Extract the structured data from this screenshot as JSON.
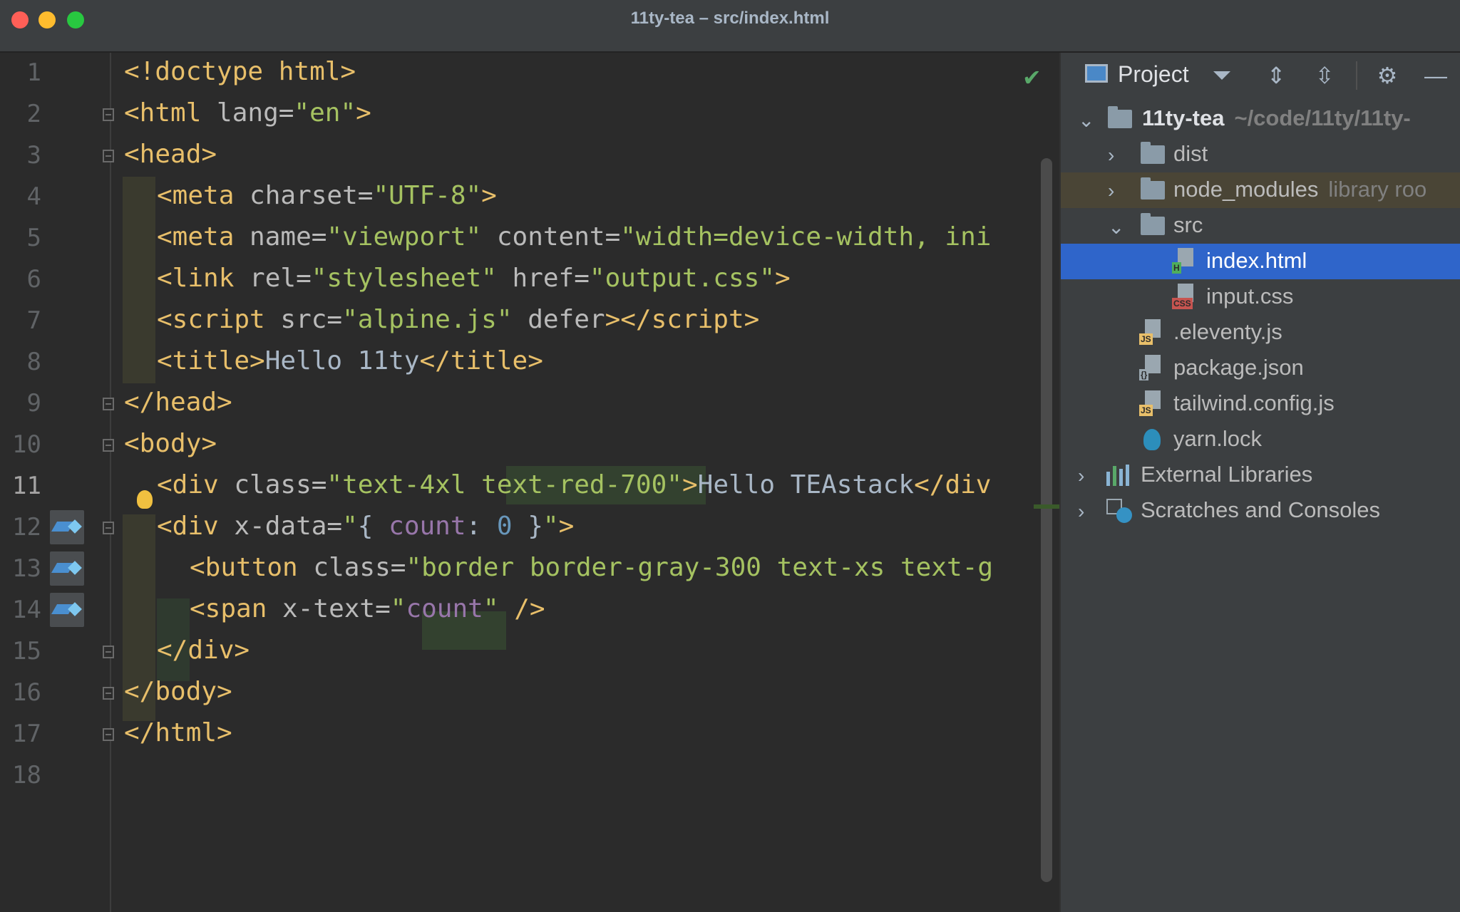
{
  "window": {
    "title": "11ty-tea – src/index.html"
  },
  "editor": {
    "current_line": 11,
    "lines": [
      {
        "num": "1"
      },
      {
        "num": "2"
      },
      {
        "num": "3"
      },
      {
        "num": "4"
      },
      {
        "num": "5"
      },
      {
        "num": "6"
      },
      {
        "num": "7"
      },
      {
        "num": "8"
      },
      {
        "num": "9"
      },
      {
        "num": "10"
      },
      {
        "num": "11"
      },
      {
        "num": "12"
      },
      {
        "num": "13"
      },
      {
        "num": "14"
      },
      {
        "num": "15"
      },
      {
        "num": "16"
      },
      {
        "num": "17"
      },
      {
        "num": "18"
      }
    ],
    "code": {
      "l1": [
        "<!doctype html>"
      ],
      "l2": [
        "<html",
        " lang=",
        "\"en\"",
        ">"
      ],
      "l3": [
        "<head>"
      ],
      "l4": [
        "<meta",
        " charset=",
        "\"UTF-8\"",
        ">"
      ],
      "l5": [
        "<meta",
        " name=",
        "\"viewport\"",
        " content=",
        "\"width=device-width, ini"
      ],
      "l6": [
        "<link",
        " rel=",
        "\"stylesheet\"",
        " href=",
        "\"output.css\"",
        ">"
      ],
      "l7": [
        "<script",
        " src=",
        "\"alpine.js\"",
        " defer",
        "></",
        "script>"
      ],
      "l8": [
        "<title>",
        "Hello 11ty",
        "</",
        "title>"
      ],
      "l9": [
        "</",
        "head>"
      ],
      "l10": [
        "<body>"
      ],
      "l11": [
        "<div",
        " class=",
        "\"text-4xl ",
        "text-red-700",
        "\"",
        ">",
        "Hello TEAstack",
        "</",
        "div"
      ],
      "l12": [
        "<div",
        " x-data=",
        "\"",
        "{ ",
        "count",
        ": ",
        "0",
        " }",
        "\"",
        ">"
      ],
      "l13": [
        "<button",
        " class=",
        "\"border border-gray-300 text-xs text-g"
      ],
      "l14": [
        "<span",
        " x-text=",
        "\"",
        "count",
        "\"",
        " />"
      ],
      "l15": [
        "</",
        "div>"
      ],
      "l16": [
        "</",
        "body>"
      ],
      "l17": [
        "</",
        "html>"
      ]
    }
  },
  "project_panel": {
    "title": "Project",
    "root": {
      "name": "11ty-tea",
      "path": "~/code/11ty/11ty-"
    },
    "items": {
      "dist": "dist",
      "node_modules": "node_modules",
      "node_modules_hint": "library roo",
      "src": "src",
      "index_html": "index.html",
      "input_css": "input.css",
      "eleventy": ".eleventy.js",
      "package_json": "package.json",
      "tailwind": "tailwind.config.js",
      "yarn_lock": "yarn.lock",
      "external_libraries": "External Libraries",
      "scratches": "Scratches and Consoles"
    },
    "file_tags": {
      "html": "H",
      "css": "CSS",
      "js": "JS",
      "json": "{}"
    },
    "colors": {
      "selection": "#2f65ca",
      "accent_tag": "#e8bf6a",
      "html_tag": "#4fae5b",
      "css_tag": "#c75450"
    }
  }
}
